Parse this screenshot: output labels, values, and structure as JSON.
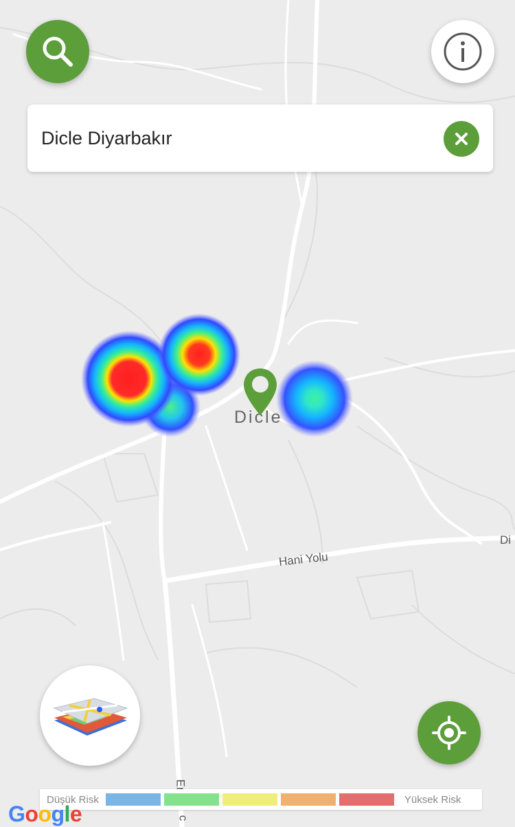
{
  "search": {
    "query": "Dicle Diyarbakır"
  },
  "map": {
    "town_label": "Dicle",
    "road_label_1": "Hani Yolu",
    "road_label_edge": "Di",
    "road_label_vertical": "Er",
    "road_label_vertical_2": "c"
  },
  "legend": {
    "low_label": "Düşük Risk",
    "high_label": "Yüksek Risk",
    "colors": [
      "#79b6e6",
      "#84e28e",
      "#f0ee7a",
      "#f0b070",
      "#e36e6e"
    ]
  },
  "branding": {
    "google": "Google"
  },
  "colors": {
    "accent": "#5c9e3a",
    "heat_high": "#ff2a2a",
    "heat_mid": "#ffe800",
    "heat_low": "#2b5cff"
  },
  "icons": {
    "search": "search-icon",
    "info": "info-icon",
    "clear": "close-icon",
    "locate": "crosshair-icon",
    "layers": "map-layers-icon",
    "marker": "location-pin-icon"
  }
}
